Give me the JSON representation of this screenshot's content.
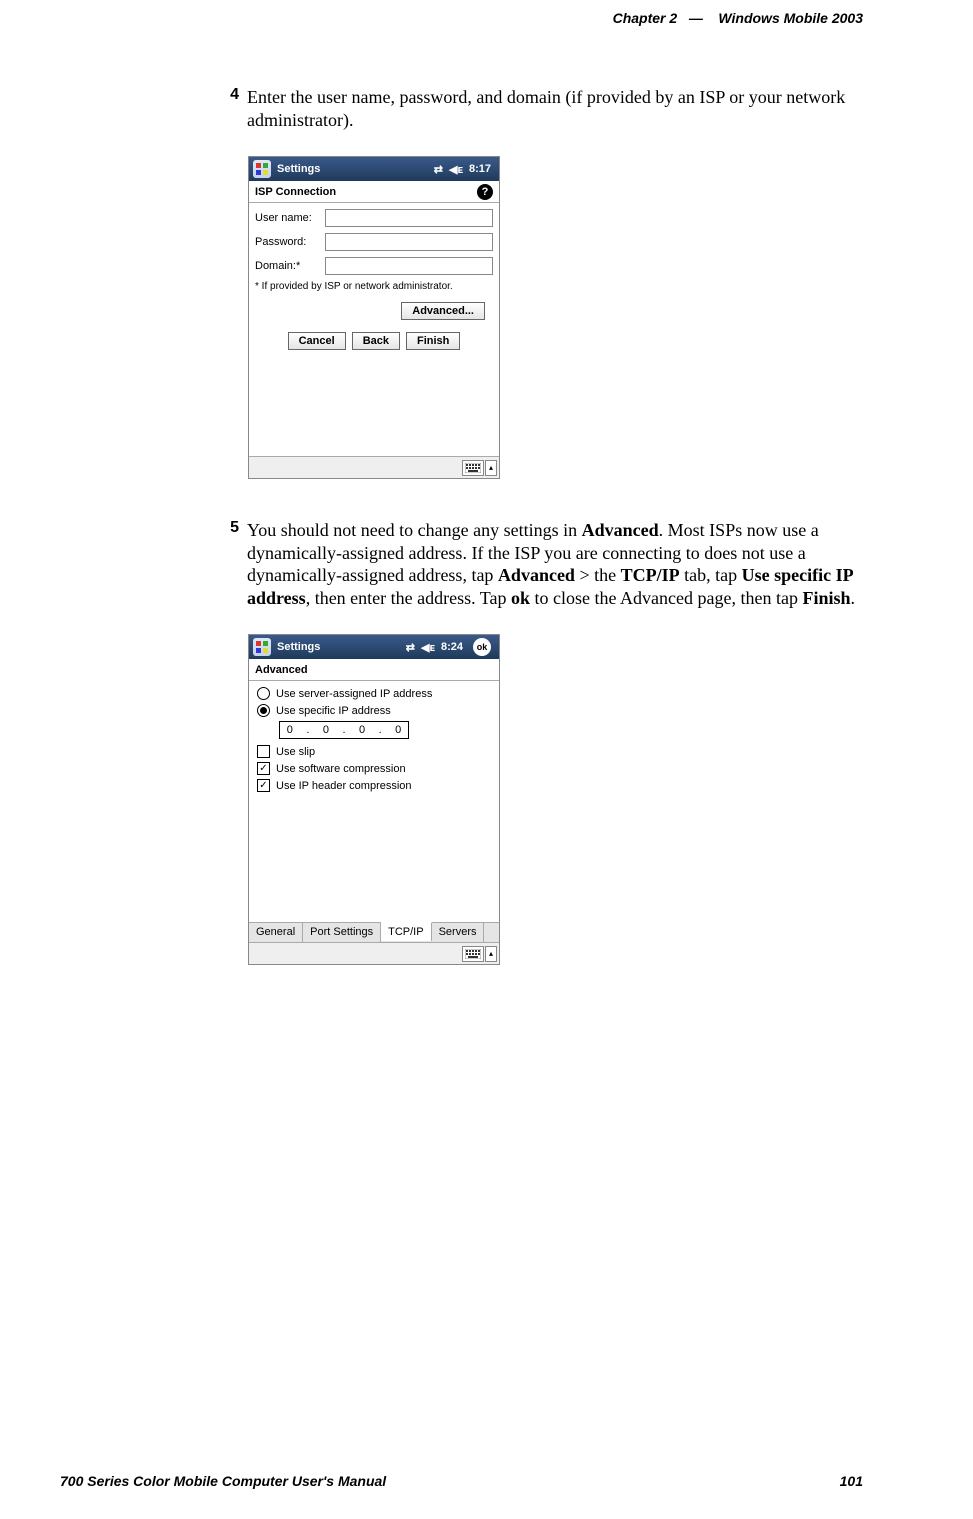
{
  "header": {
    "chapter": "Chapter  2",
    "separator": "—",
    "title": "Windows Mobile 2003"
  },
  "steps": {
    "s4": {
      "num": "4",
      "text": "Enter the user name, password, and domain (if provided by an ISP or your network administrator)."
    },
    "s5": {
      "num": "5",
      "t1": "You should not need to change any settings in ",
      "b1": "Advanced",
      "t2": ". Most ISPs now use a dynamically-assigned address. If the ISP you are connecting to does not use a dynamically-assigned address, tap ",
      "b2": "Advanced",
      "t3": " > the ",
      "b3": "TCP/IP",
      "t4": " tab, tap ",
      "b4": "Use specific IP address",
      "t5": ", then enter the address. Tap ",
      "b5": "ok",
      "t6": " to close the Advanced page, then tap ",
      "b6": "Finish",
      "t7": "."
    }
  },
  "shot1": {
    "taskbar_title": "Settings",
    "time": "8:17",
    "title": "ISP Connection",
    "labels": {
      "user": "User name:",
      "pwd": "Password:",
      "domain": "Domain:*"
    },
    "footnote": "* If provided by ISP or network administrator.",
    "buttons": {
      "advanced": "Advanced...",
      "cancel": "Cancel",
      "back": "Back",
      "finish": "Finish"
    }
  },
  "shot2": {
    "taskbar_title": "Settings",
    "time": "8:24",
    "ok": "ok",
    "title": "Advanced",
    "radio_server": "Use server-assigned IP address",
    "radio_specific": "Use specific IP address",
    "ip": {
      "a": "0",
      "b": "0",
      "c": "0",
      "d": "0",
      "dot": "."
    },
    "check_slip": "Use slip",
    "check_sw": "Use software compression",
    "check_iphdr": "Use IP header compression",
    "tabs": {
      "general": "General",
      "port": "Port Settings",
      "tcpip": "TCP/IP",
      "servers": "Servers"
    }
  },
  "footer": {
    "left": "700 Series Color Mobile Computer User's Manual",
    "right": "101"
  }
}
